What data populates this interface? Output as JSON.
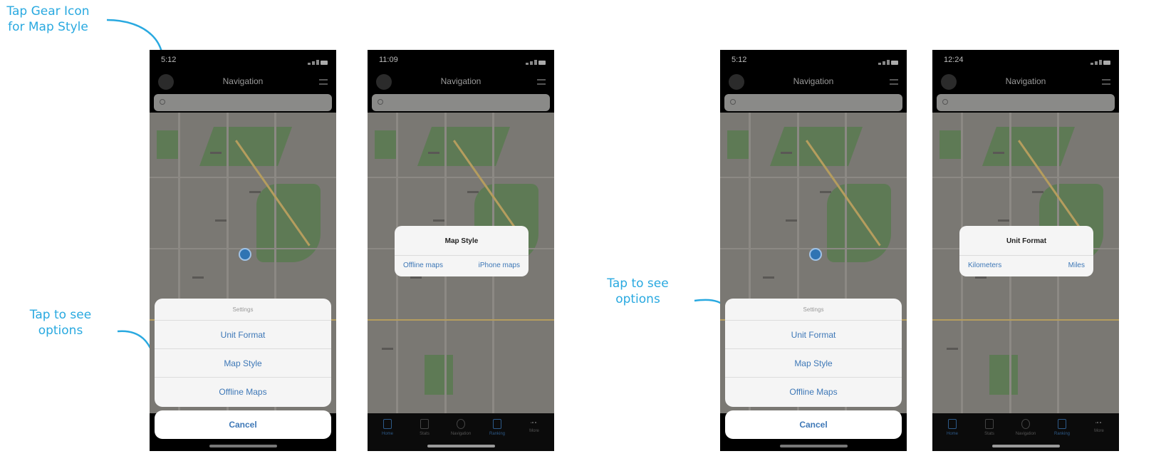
{
  "annotations": {
    "gear": "Tap Gear Icon\nfor  Map Style",
    "tap_left": "Tap to see\noptions",
    "tap_right": "Tap to see\noptions"
  },
  "colors": {
    "accent": "#29a9e0",
    "ios_blue": "#3e78b7",
    "map": "#7a7873",
    "sheet": "#f5f5f5"
  },
  "nav_title": "Navigation",
  "tabs": [
    "Home",
    "Stats",
    "Navigation",
    "Ranking",
    "More"
  ],
  "phones": [
    {
      "time": "5:12",
      "sheet": {
        "title": "Settings",
        "items": [
          "Unit Format",
          "Map Style",
          "Offline Maps"
        ],
        "cancel": "Cancel"
      }
    },
    {
      "time": "11:09",
      "alert": {
        "title": "Map Style",
        "options": [
          "Offline maps",
          "iPhone maps"
        ]
      }
    },
    {
      "time": "5:12",
      "sheet": {
        "title": "Settings",
        "items": [
          "Unit Format",
          "Map Style",
          "Offline Maps"
        ],
        "cancel": "Cancel"
      }
    },
    {
      "time": "12:24",
      "alert": {
        "title": "Unit Format",
        "options": [
          "Kilometers",
          "Miles"
        ]
      }
    }
  ],
  "icons": {
    "gear": "gear-icon",
    "search": "search-icon",
    "menu": "menu-icon",
    "location": "location-pin-icon"
  }
}
